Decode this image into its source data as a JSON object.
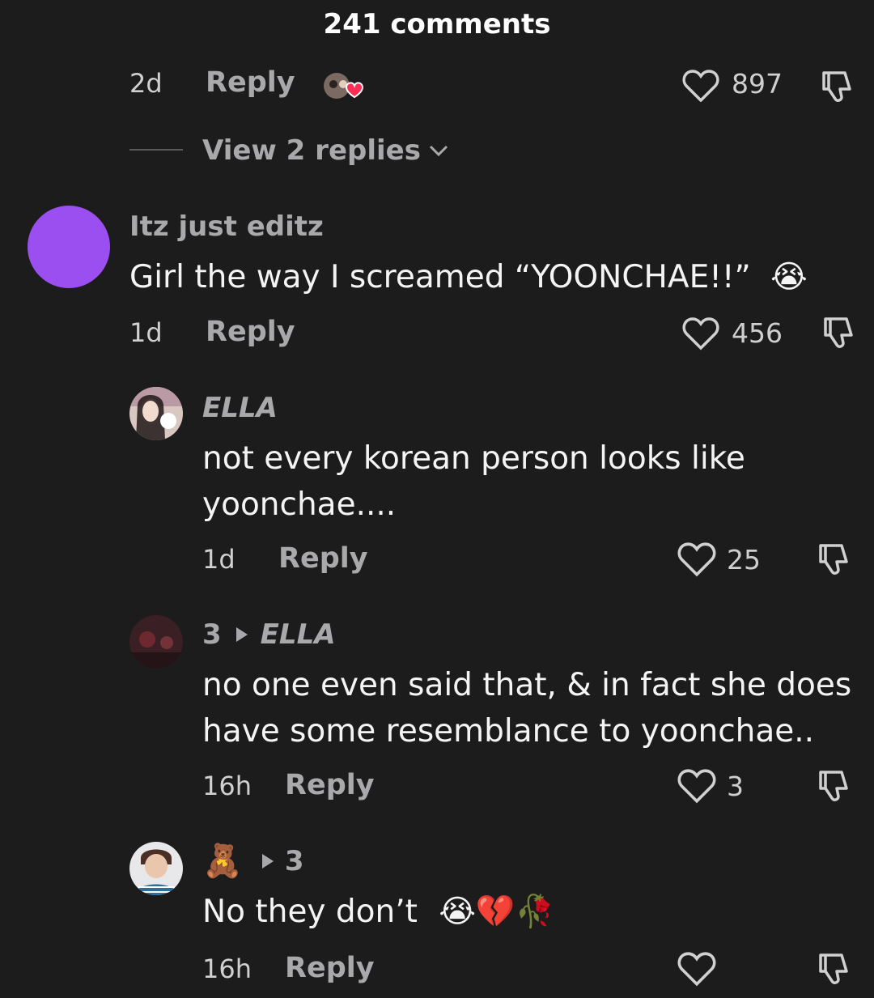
{
  "header": {
    "title": "241 comments"
  },
  "top_comment": {
    "time": "2d",
    "reply_label": "Reply",
    "like_count": "897",
    "view_replies": "View 2 replies"
  },
  "comments": [
    {
      "username": "Itz just editz",
      "text": "Girl the way I screamed “YOONCHAE!!”",
      "emoji": "😭",
      "time": "1d",
      "reply_label": "Reply",
      "like_count": "456",
      "avatar_color": "#9c4ff0"
    },
    {
      "username": "ELLA",
      "text_line1": "not every korean person looks like",
      "text_line2": "yoonchae....",
      "time": "1d",
      "reply_label": "Reply",
      "like_count": "25"
    },
    {
      "username_from": "3",
      "username_to": "ELLA",
      "text_line1": "no one even said that, & in fact she does",
      "text_line2": "have some resemblance to yoonchae..",
      "time": "16h",
      "reply_label": "Reply",
      "like_count": "3"
    },
    {
      "username_from": "🧸",
      "username_to": "3",
      "text": "No they don’t",
      "emojis": "😭💔🥀",
      "time": "16h",
      "reply_label": "Reply",
      "like_count": ""
    }
  ],
  "icons": {
    "like": "heart-outline-icon",
    "dislike": "thumbs-down-outline-icon",
    "chevron": "chevron-down-icon",
    "reply_arrow": "play-triangle-icon"
  },
  "colors": {
    "background": "#1c1c1d",
    "text_primary": "#f4f4f4",
    "text_secondary": "#a9a9ab",
    "avatar_purple": "#9c4ff0"
  }
}
